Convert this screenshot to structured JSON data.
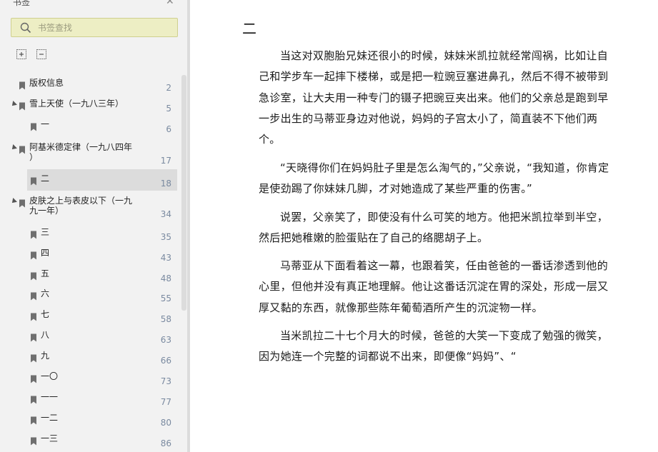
{
  "sidebar": {
    "title": "书签",
    "search": {
      "placeholder": "书签查找",
      "value": ""
    },
    "tools": [
      "expand-all-icon",
      "collapse-all-icon"
    ],
    "bookmarks": [
      {
        "label": "版权信息",
        "page": "2",
        "level": 0,
        "expander": false
      },
      {
        "label": "雪上天使（一九八三年）",
        "page": "5",
        "level": 0,
        "expander": true
      },
      {
        "label": "一",
        "page": "6",
        "level": 1,
        "expander": false
      },
      {
        "label": "阿基米德定律（一九八四年\n）",
        "page": "17",
        "level": 0,
        "expander": true
      },
      {
        "label": "二",
        "page": "18",
        "level": 1,
        "expander": false,
        "selected": true
      },
      {
        "label": "皮肤之上与表皮以下（一九\n九一年）",
        "page": "34",
        "level": 0,
        "expander": true
      },
      {
        "label": "三",
        "page": "35",
        "level": 1,
        "expander": false
      },
      {
        "label": "四",
        "page": "43",
        "level": 1,
        "expander": false
      },
      {
        "label": "五",
        "page": "48",
        "level": 1,
        "expander": false
      },
      {
        "label": "六",
        "page": "55",
        "level": 1,
        "expander": false
      },
      {
        "label": "七",
        "page": "58",
        "level": 1,
        "expander": false
      },
      {
        "label": "八",
        "page": "63",
        "level": 1,
        "expander": false
      },
      {
        "label": "九",
        "page": "66",
        "level": 1,
        "expander": false
      },
      {
        "label": "一〇",
        "page": "73",
        "level": 1,
        "expander": false
      },
      {
        "label": "一一",
        "page": "77",
        "level": 1,
        "expander": false
      },
      {
        "label": "一二",
        "page": "80",
        "level": 1,
        "expander": false
      },
      {
        "label": "一三",
        "page": "86",
        "level": 1,
        "expander": false
      }
    ]
  },
  "content": {
    "chapter_title": "二",
    "paragraphs": [
      "当这对双胞胎兄妹还很小的时候，妹妹米凯拉就经常闯祸，比如让自己和学步车一起摔下楼梯，或是把一粒豌豆塞进鼻孔，然后不得不被带到急诊室，让大夫用一种专门的镊子把豌豆夹出来。他们的父亲总是跑到早一步出生的马蒂亚身边对他说，妈妈的子宫太小了，简直装不下他们两个。",
      "“天晓得你们在妈妈肚子里是怎么淘气的，”父亲说，“我知道，你肯定是使劲踢了你妹妹几脚，才对她造成了某些严重的伤害。”",
      "说罢，父亲笑了，即使没有什么可笑的地方。他把米凯拉举到半空，然后把她稚嫩的脸蛋贴在了自己的络腮胡子上。",
      "马蒂亚从下面看着这一幕，也跟着笑，任由爸爸的一番话渗透到他的心里，但他并没有真正地理解。他让这番话沉淀在胃的深处，形成一层又厚又黏的东西，就像那些陈年葡萄酒所产生的沉淀物一样。",
      "当米凯拉二十七个月大的时候，爸爸的大笑一下变成了勉强的微笑，因为她连一个完整的词都说不出来，即便像“妈妈”、“"
    ]
  }
}
